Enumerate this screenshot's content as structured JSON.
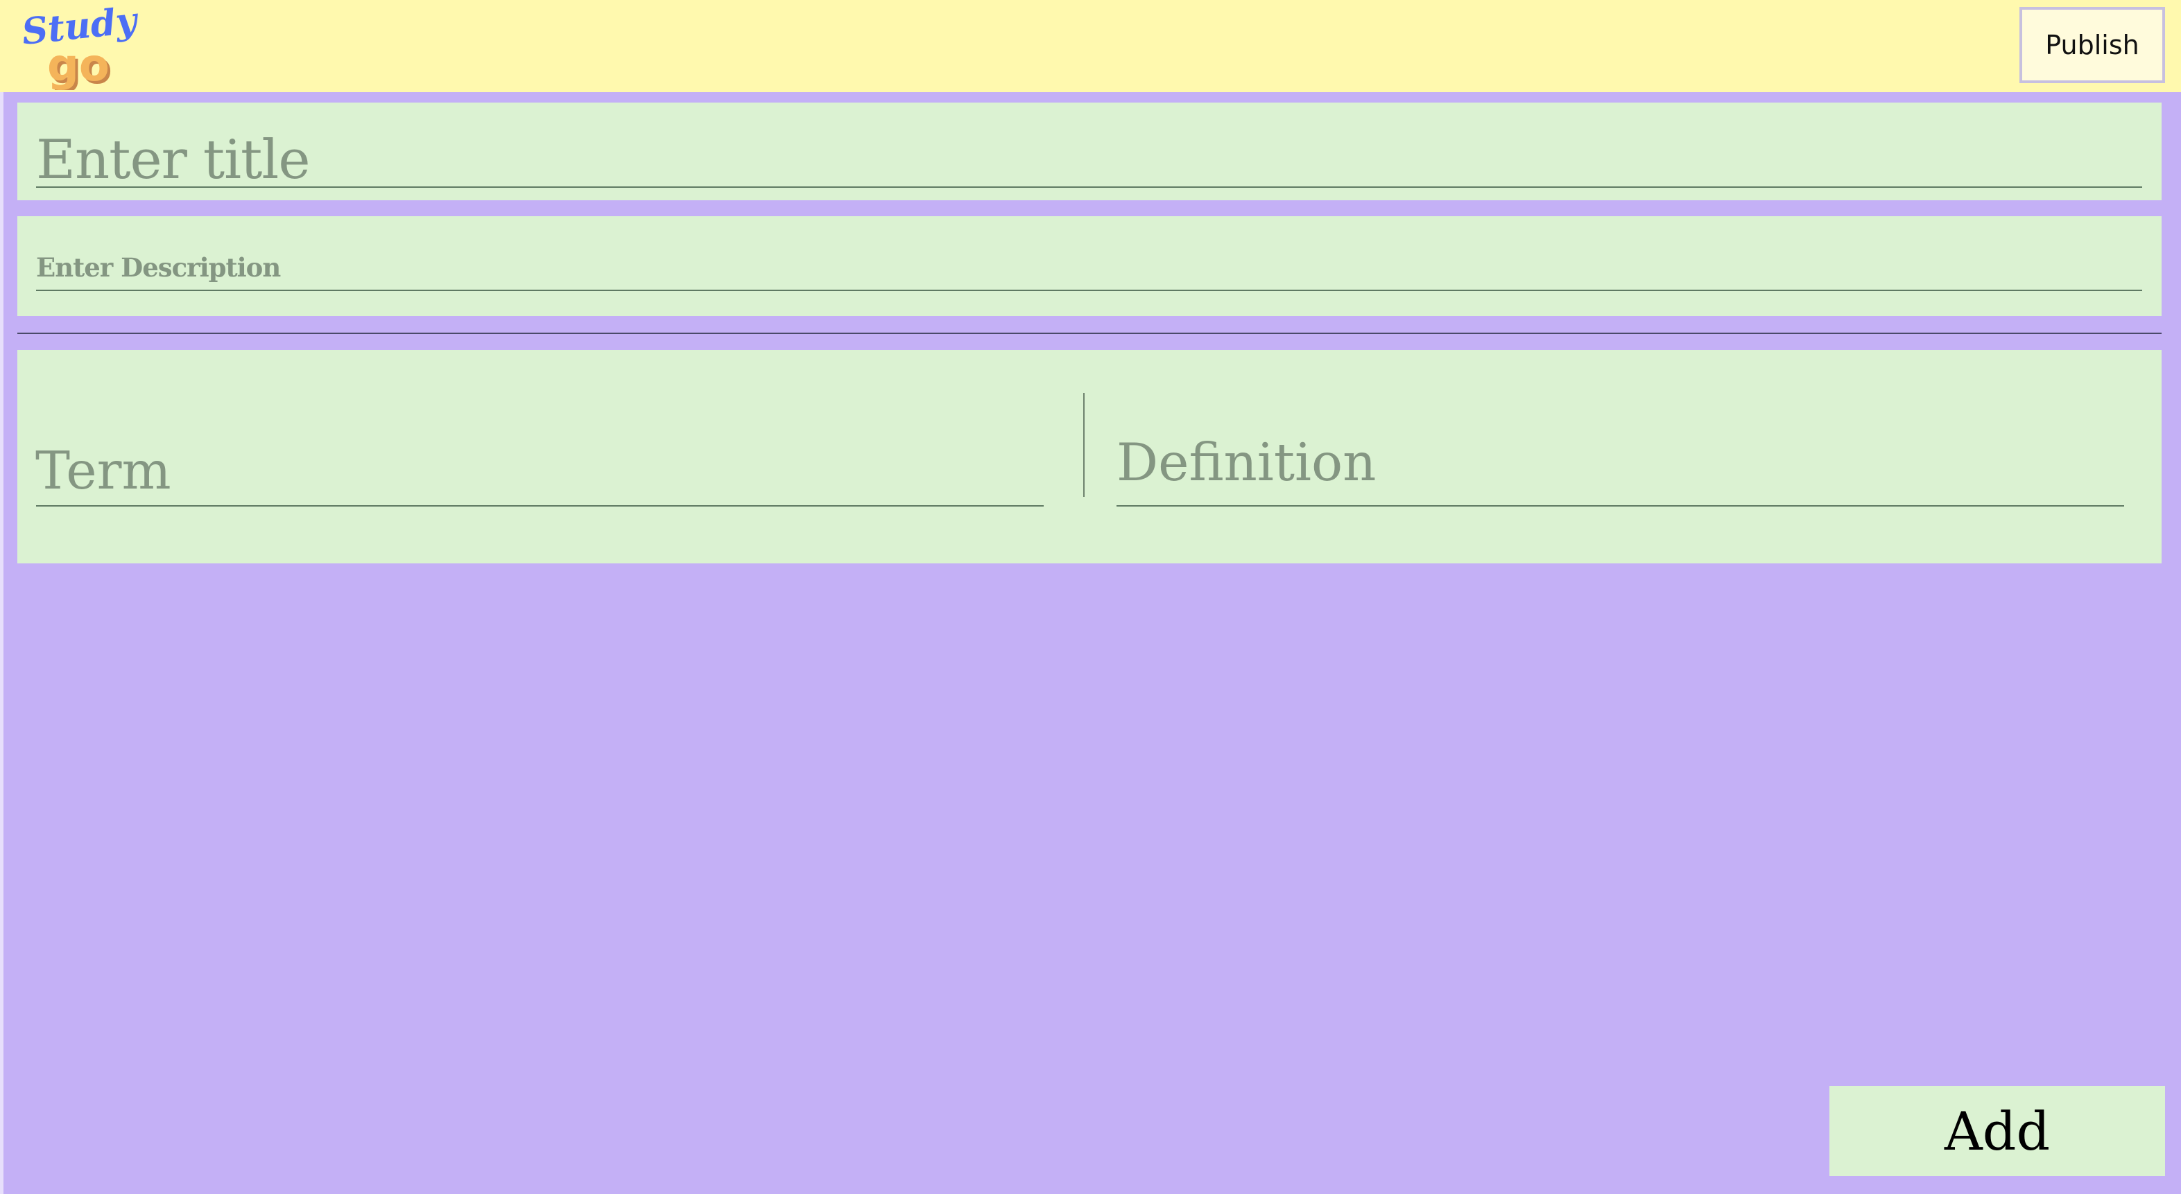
{
  "header": {
    "logo": {
      "top_text": "Study",
      "bottom_text": "go",
      "top_color": "#4c6ef5",
      "bottom_color": "#f4b45a"
    },
    "publish_label": "Publish"
  },
  "form": {
    "title": {
      "placeholder": "Enter title",
      "value": ""
    },
    "description": {
      "placeholder": "Enter Description",
      "value": ""
    }
  },
  "cards": [
    {
      "term_placeholder": "Term",
      "definition_placeholder": "Definition"
    }
  ],
  "actions": {
    "add_label": "Add"
  },
  "colors": {
    "header_bg": "#fff9ae",
    "page_bg": "#c4b0f6",
    "panel_bg": "#dbf2d2",
    "placeholder_text": "#849682",
    "publish_bg": "#fffbdc"
  }
}
